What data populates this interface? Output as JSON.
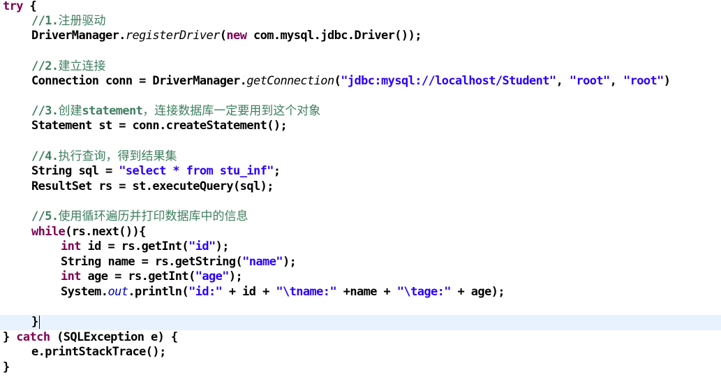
{
  "editor": {
    "language": "java",
    "lines": {
      "l01": {
        "kw": "try",
        "rest": " {"
      },
      "l02": {
        "prefix": "//1.",
        "cn": "注册驱动"
      },
      "l03": {
        "a": "DriverManager.",
        "method": "registerDriver",
        "b": "(",
        "kw": "new",
        "c": " com.mysql.jdbc.Driver());"
      },
      "l05": {
        "prefix": "//2.",
        "cn": "建立连接"
      },
      "l06": {
        "a": "Connection conn = DriverManager.",
        "method": "getConnection",
        "b": "(",
        "s1": "\"jdbc:mysql://localhost/Student\"",
        "c": ", ",
        "s2": "\"root\"",
        "d": ", ",
        "s3": "\"root\"",
        "e": ")"
      },
      "l08": {
        "prefix": "//3.",
        "en": "statement",
        "cn": "创建",
        "cn2": "，连接数据库一定要用到这个对象"
      },
      "l09": {
        "text": "Statement st = conn.createStatement();"
      },
      "l11": {
        "prefix": "//4.",
        "cn": "执行查询，得到结果集"
      },
      "l12": {
        "a": "String sql = ",
        "s": "\"select * from stu_inf\"",
        "b": ";"
      },
      "l13": {
        "text": "ResultSet rs = st.executeQuery(sql);"
      },
      "l15": {
        "prefix": "//5.",
        "cn": "使用循环遍历并打印数据库中的信息"
      },
      "l16": {
        "kw": "while",
        "rest": "(rs.next()){"
      },
      "l17": {
        "kw": "int",
        "a": " id = rs.getInt(",
        "s": "\"id\"",
        "b": ");"
      },
      "l18": {
        "a": "String name = rs.getString(",
        "s": "\"name\"",
        "b": ");"
      },
      "l19": {
        "kw": "int",
        "a": " age = rs.getInt(",
        "s": "\"age\"",
        "b": ");"
      },
      "l20": {
        "a": "System.",
        "field": "out",
        "b": ".println(",
        "s1": "\"id:\"",
        "c": " + id + ",
        "s2": "\"\\tname:\"",
        "d": " +name + ",
        "s3": "\"\\tage:\"",
        "e": " + age);"
      },
      "l22": {
        "text": "}"
      },
      "l23": {
        "a": "} ",
        "kw": "catch",
        "b": " (SQLException e) {"
      },
      "l24": {
        "text": "e.printStackTrace();"
      },
      "l25": {
        "text": "}"
      }
    }
  }
}
